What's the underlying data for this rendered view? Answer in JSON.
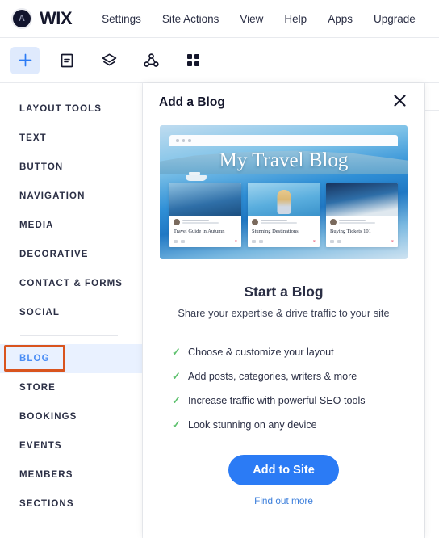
{
  "topbar": {
    "avatar_initial": "A",
    "brand": "WIX",
    "menu": [
      {
        "label": "Settings"
      },
      {
        "label": "Site Actions"
      },
      {
        "label": "View"
      },
      {
        "label": "Help"
      },
      {
        "label": "Apps"
      },
      {
        "label": "Upgrade"
      }
    ]
  },
  "toolbar": {
    "tools": [
      {
        "name": "add-elements",
        "icon": "plus-icon",
        "active": true
      },
      {
        "name": "pages",
        "icon": "page-icon",
        "active": false
      },
      {
        "name": "layers",
        "icon": "layers-icon",
        "active": false
      },
      {
        "name": "site-structure",
        "icon": "connections-icon",
        "active": false
      },
      {
        "name": "apps",
        "icon": "grid-apps-icon",
        "active": false
      }
    ]
  },
  "sidebar": {
    "items": [
      {
        "label": "LAYOUT TOOLS",
        "selected": false
      },
      {
        "label": "TEXT",
        "selected": false
      },
      {
        "label": "BUTTON",
        "selected": false
      },
      {
        "label": "NAVIGATION",
        "selected": false
      },
      {
        "label": "MEDIA",
        "selected": false
      },
      {
        "label": "DECORATIVE",
        "selected": false
      },
      {
        "label": "CONTACT & FORMS",
        "selected": false
      },
      {
        "label": "SOCIAL",
        "selected": false
      }
    ],
    "items_secondary": [
      {
        "label": "BLOG",
        "selected": true
      },
      {
        "label": "STORE",
        "selected": false
      },
      {
        "label": "BOOKINGS",
        "selected": false
      },
      {
        "label": "EVENTS",
        "selected": false
      },
      {
        "label": "MEMBERS",
        "selected": false
      },
      {
        "label": "SECTIONS",
        "selected": false
      }
    ]
  },
  "panel": {
    "title": "Add a Blog",
    "close_icon": "close-icon",
    "preview": {
      "site_title": "My Travel Blog",
      "cards": [
        {
          "title": "Travel Guide in Autumn"
        },
        {
          "title": "Stunning Destinations"
        },
        {
          "title": "Buying Tickets 101"
        }
      ]
    },
    "heading": "Start a Blog",
    "subheading": "Share your expertise & drive traffic to your site",
    "features": [
      {
        "text": "Choose & customize your layout"
      },
      {
        "text": "Add posts, categories, writers & more"
      },
      {
        "text": "Increase traffic with powerful SEO tools"
      },
      {
        "text": "Look stunning on any device"
      }
    ],
    "cta_label": "Add to Site",
    "secondary_link": "Find out more"
  },
  "colors": {
    "accent_blue": "#2b7bf5",
    "selection_orange": "#d9541e",
    "selected_row_bg": "#e9f1ff",
    "check_green": "#5ec16e",
    "link_blue": "#3b7edb"
  }
}
